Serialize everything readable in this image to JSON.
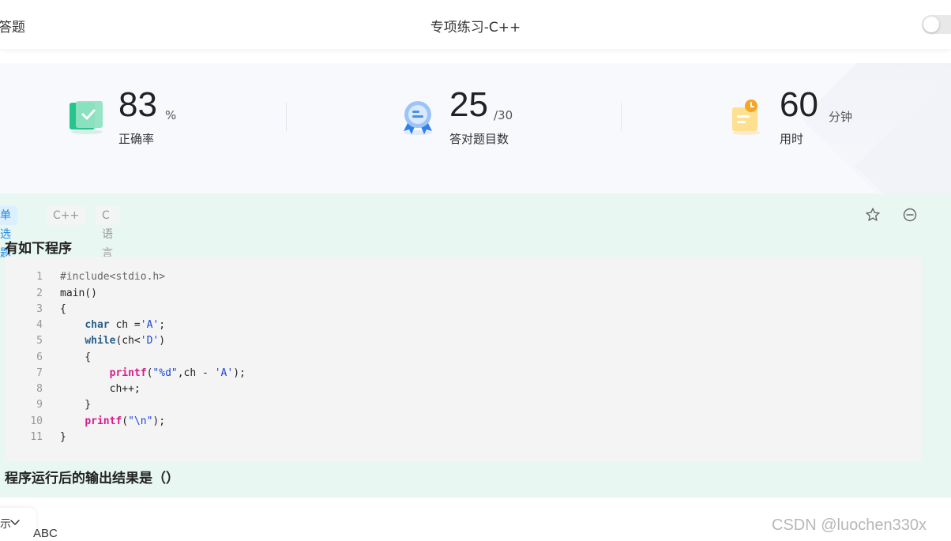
{
  "header": {
    "back_label": "答题",
    "title": "专项练习-C++"
  },
  "stats": [
    {
      "value": "83",
      "unit": "%",
      "label": "正确率"
    },
    {
      "value": "25",
      "unit": "/30",
      "label": "答对题目数"
    },
    {
      "value": "60",
      "unit": "分钟",
      "label": "用时"
    }
  ],
  "question": {
    "type": "单选题",
    "tags": [
      "C++",
      "C语言"
    ],
    "title": "有如下程序",
    "code_line_numbers": [
      "1",
      "2",
      "3",
      "4",
      "5",
      "6",
      "7",
      "8",
      "9",
      "10",
      "11"
    ],
    "footer": "程序运行后的输出结果是（）"
  },
  "bottom": {
    "dropdown_label": "示",
    "answer_option": "ABC"
  },
  "watermark": "CSDN @luochen330x",
  "colors": {
    "accent_blue": "#1e88e5",
    "question_bg": "#e8f7f2",
    "code_bg": "#f4f4f4",
    "keyword": "#2b5f86",
    "function": "#d81b8c",
    "string": "#1b46d6"
  }
}
